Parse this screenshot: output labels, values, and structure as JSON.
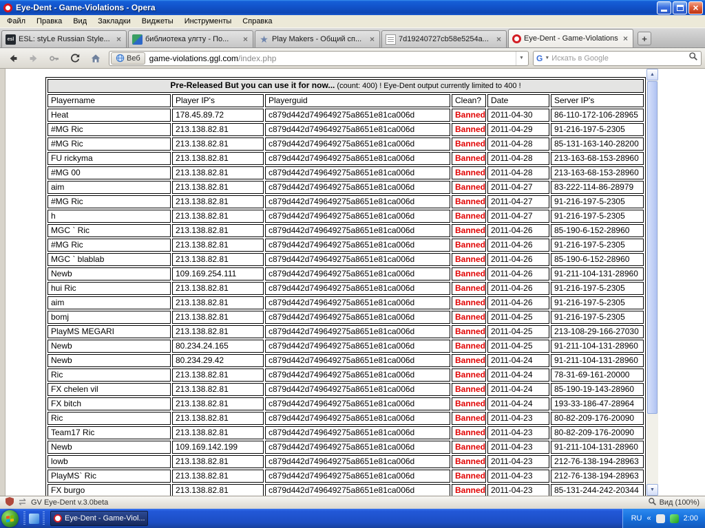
{
  "window": {
    "title": "Eye-Dent - Game-Violations - Opera"
  },
  "menu": {
    "items": [
      "Файл",
      "Правка",
      "Вид",
      "Закладки",
      "Виджеты",
      "Инструменты",
      "Справка"
    ]
  },
  "tabs": [
    {
      "label": "ESL: styLe Russian Style...",
      "icon": "esl",
      "glyph": "esl",
      "active": false
    },
    {
      "label": "библиотека улгту - По...",
      "icon": "book",
      "glyph": "",
      "active": false
    },
    {
      "label": "Play Makers - Общий сп...",
      "icon": "star",
      "glyph": "★",
      "active": false
    },
    {
      "label": "7d19240727cb58e5254a...",
      "icon": "doc",
      "glyph": "",
      "active": false
    },
    {
      "label": "Eye-Dent - Game-Violations",
      "icon": "opera",
      "glyph": "",
      "active": true
    }
  ],
  "navbar": {
    "badge": "Веб",
    "address_domain": "game-violations.ggl.com",
    "address_path": "/index.php",
    "search_engine_glyph": "G",
    "search_placeholder": "Искать в Google"
  },
  "table": {
    "banner_bold": "Pre-Released But you can use it for now...",
    "banner_rest": "(count: 400) ! Eye-Dent output currently limited to 400 !",
    "columns": [
      "Playername",
      "Player IP's",
      "Playerguid",
      "Clean?",
      "Date",
      "Server IP's"
    ],
    "rows": [
      [
        "Heat",
        "178.45.89.72",
        "c879d442d749649275a8651e81ca006d",
        "Banned",
        "2011-04-30",
        "86-110-172-106-28965"
      ],
      [
        "#MG Ric",
        "213.138.82.81",
        "c879d442d749649275a8651e81ca006d",
        "Banned",
        "2011-04-29",
        "91-216-197-5-2305"
      ],
      [
        "#MG Ric",
        "213.138.82.81",
        "c879d442d749649275a8651e81ca006d",
        "Banned",
        "2011-04-28",
        "85-131-163-140-28200"
      ],
      [
        "FU rickyma",
        "213.138.82.81",
        "c879d442d749649275a8651e81ca006d",
        "Banned",
        "2011-04-28",
        "213-163-68-153-28960"
      ],
      [
        "#MG 00",
        "213.138.82.81",
        "c879d442d749649275a8651e81ca006d",
        "Banned",
        "2011-04-28",
        "213-163-68-153-28960"
      ],
      [
        "aim",
        "213.138.82.81",
        "c879d442d749649275a8651e81ca006d",
        "Banned",
        "2011-04-27",
        "83-222-114-86-28979"
      ],
      [
        "#MG Ric",
        "213.138.82.81",
        "c879d442d749649275a8651e81ca006d",
        "Banned",
        "2011-04-27",
        "91-216-197-5-2305"
      ],
      [
        "h",
        "213.138.82.81",
        "c879d442d749649275a8651e81ca006d",
        "Banned",
        "2011-04-27",
        "91-216-197-5-2305"
      ],
      [
        "MGC ` Ric",
        "213.138.82.81",
        "c879d442d749649275a8651e81ca006d",
        "Banned",
        "2011-04-26",
        "85-190-6-152-28960"
      ],
      [
        "#MG Ric",
        "213.138.82.81",
        "c879d442d749649275a8651e81ca006d",
        "Banned",
        "2011-04-26",
        "91-216-197-5-2305"
      ],
      [
        "MGC ` blablab",
        "213.138.82.81",
        "c879d442d749649275a8651e81ca006d",
        "Banned",
        "2011-04-26",
        "85-190-6-152-28960"
      ],
      [
        "Newb",
        "109.169.254.111",
        "c879d442d749649275a8651e81ca006d",
        "Banned",
        "2011-04-26",
        "91-211-104-131-28960"
      ],
      [
        "hui Ric",
        "213.138.82.81",
        "c879d442d749649275a8651e81ca006d",
        "Banned",
        "2011-04-26",
        "91-216-197-5-2305"
      ],
      [
        "aim",
        "213.138.82.81",
        "c879d442d749649275a8651e81ca006d",
        "Banned",
        "2011-04-26",
        "91-216-197-5-2305"
      ],
      [
        "bomj",
        "213.138.82.81",
        "c879d442d749649275a8651e81ca006d",
        "Banned",
        "2011-04-25",
        "91-216-197-5-2305"
      ],
      [
        "PlayMS MEGARI",
        "213.138.82.81",
        "c879d442d749649275a8651e81ca006d",
        "Banned",
        "2011-04-25",
        "213-108-29-166-27030"
      ],
      [
        "Newb",
        "80.234.24.165",
        "c879d442d749649275a8651e81ca006d",
        "Banned",
        "2011-04-25",
        "91-211-104-131-28960"
      ],
      [
        "Newb",
        "80.234.29.42",
        "c879d442d749649275a8651e81ca006d",
        "Banned",
        "2011-04-24",
        "91-211-104-131-28960"
      ],
      [
        "Ric",
        "213.138.82.81",
        "c879d442d749649275a8651e81ca006d",
        "Banned",
        "2011-04-24",
        "78-31-69-161-20000"
      ],
      [
        "FX chelen vil",
        "213.138.82.81",
        "c879d442d749649275a8651e81ca006d",
        "Banned",
        "2011-04-24",
        "85-190-19-143-28960"
      ],
      [
        "FX bitch",
        "213.138.82.81",
        "c879d442d749649275a8651e81ca006d",
        "Banned",
        "2011-04-24",
        "193-33-186-47-28964"
      ],
      [
        "Ric",
        "213.138.82.81",
        "c879d442d749649275a8651e81ca006d",
        "Banned",
        "2011-04-23",
        "80-82-209-176-20090"
      ],
      [
        "Team17 Ric",
        "213.138.82.81",
        "c879d442d749649275a8651e81ca006d",
        "Banned",
        "2011-04-23",
        "80-82-209-176-20090"
      ],
      [
        "Newb",
        "109.169.142.199",
        "c879d442d749649275a8651e81ca006d",
        "Banned",
        "2011-04-23",
        "91-211-104-131-28960"
      ],
      [
        "lowb",
        "213.138.82.81",
        "c879d442d749649275a8651e81ca006d",
        "Banned",
        "2011-04-23",
        "212-76-138-194-28963"
      ],
      [
        "PlayMS` Ric",
        "213.138.82.81",
        "c879d442d749649275a8651e81ca006d",
        "Banned",
        "2011-04-23",
        "212-76-138-194-28963"
      ],
      [
        "FX burgo",
        "213.138.82.81",
        "c879d442d749649275a8651e81ca006d",
        "Banned",
        "2011-04-23",
        "85-131-244-242-20344"
      ]
    ]
  },
  "statusbar": {
    "text": "GV Eye-Dent v.3.0beta",
    "zoom": "Вид (100%)"
  },
  "taskbar": {
    "task_label": "Eye-Dent - Game-Viol...",
    "tray": {
      "lang": "RU",
      "chevron": "«",
      "time": "2:00"
    }
  },
  "ui": {
    "close_glyph": "×",
    "tab_close_glyph": "×",
    "new_tab_glyph": "+",
    "dropdown_glyph": "▼",
    "scroll_up": "▲",
    "scroll_down": "▼"
  },
  "colors": {
    "banned_red": "#e10000",
    "taskbar_blue": "#2258d8",
    "banner_bg": "#e4e4e3"
  }
}
